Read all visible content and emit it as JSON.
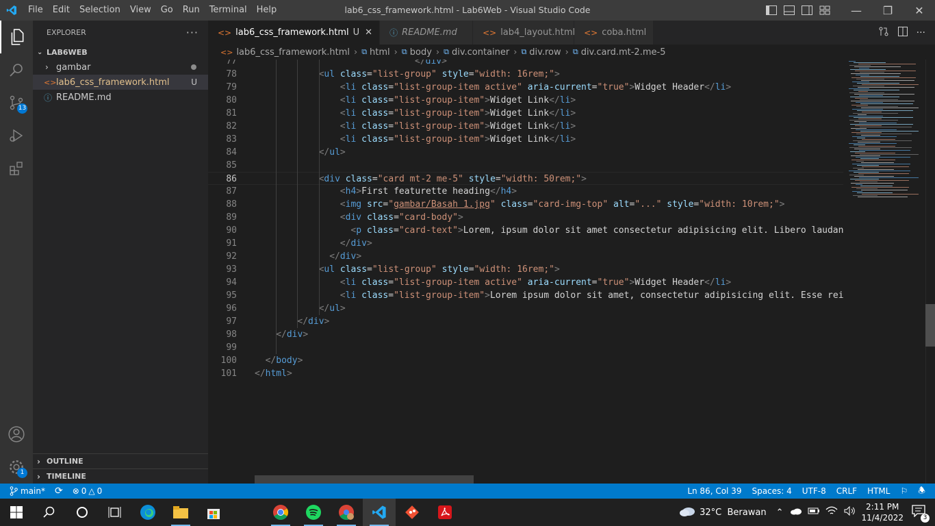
{
  "titlebar": {
    "menu": [
      "File",
      "Edit",
      "Selection",
      "View",
      "Go",
      "Run",
      "Terminal",
      "Help"
    ],
    "window_title": "lab6_css_framework.html - Lab6Web - Visual Studio Code"
  },
  "activity_bar": {
    "items": [
      "explorer-icon",
      "search-icon",
      "source-control-icon",
      "run-debug-icon",
      "extensions-icon"
    ],
    "source_control_badge": "13",
    "settings_badge": "1"
  },
  "explorer": {
    "header": "EXPLORER",
    "more": "···",
    "folder": "LAB6WEB",
    "items": [
      {
        "label": "gambar",
        "type": "folder"
      },
      {
        "label": "lab6_css_framework.html",
        "type": "html",
        "status": "U"
      },
      {
        "label": "README.md",
        "type": "md"
      }
    ],
    "outline": "OUTLINE",
    "timeline": "TIMELINE"
  },
  "tabs": [
    {
      "label": "lab6_css_framework.html",
      "status": "U",
      "active": true
    },
    {
      "label": "README.md"
    },
    {
      "label": "lab4_layout.html"
    },
    {
      "label": "coba.html"
    }
  ],
  "breadcrumb": [
    "lab6_css_framework.html",
    "html",
    "body",
    "div.container",
    "div.row",
    "div.card.mt-2.me-5"
  ],
  "editor": {
    "lines": [
      {
        "n": "77",
        "indent": 30,
        "segs": [
          [
            "b",
            "</"
          ],
          [
            "t",
            "div"
          ],
          [
            "b",
            ">"
          ]
        ]
      },
      {
        "n": "78",
        "indent": 12,
        "segs": [
          [
            "b",
            "<"
          ],
          [
            "t",
            "ul"
          ],
          [
            "w",
            " "
          ],
          [
            "a",
            "class"
          ],
          [
            "w",
            "="
          ],
          [
            "s",
            "\"list-group\""
          ],
          [
            "w",
            " "
          ],
          [
            "a",
            "style"
          ],
          [
            "w",
            "="
          ],
          [
            "s",
            "\"width: 16rem;\""
          ],
          [
            "b",
            ">"
          ]
        ]
      },
      {
        "n": "79",
        "indent": 16,
        "segs": [
          [
            "b",
            "<"
          ],
          [
            "t",
            "li"
          ],
          [
            "w",
            " "
          ],
          [
            "a",
            "class"
          ],
          [
            "w",
            "="
          ],
          [
            "s",
            "\"list-group-item active\""
          ],
          [
            "w",
            " "
          ],
          [
            "a",
            "aria-current"
          ],
          [
            "w",
            "="
          ],
          [
            "s",
            "\"true\""
          ],
          [
            "b",
            ">"
          ],
          [
            "w",
            "Widget Header"
          ],
          [
            "b",
            "</"
          ],
          [
            "t",
            "li"
          ],
          [
            "b",
            ">"
          ]
        ]
      },
      {
        "n": "80",
        "indent": 16,
        "segs": [
          [
            "b",
            "<"
          ],
          [
            "t",
            "li"
          ],
          [
            "w",
            " "
          ],
          [
            "a",
            "class"
          ],
          [
            "w",
            "="
          ],
          [
            "s",
            "\"list-group-item\""
          ],
          [
            "b",
            ">"
          ],
          [
            "w",
            "Widget Link"
          ],
          [
            "b",
            "</"
          ],
          [
            "t",
            "li"
          ],
          [
            "b",
            ">"
          ]
        ]
      },
      {
        "n": "81",
        "indent": 16,
        "segs": [
          [
            "b",
            "<"
          ],
          [
            "t",
            "li"
          ],
          [
            "w",
            " "
          ],
          [
            "a",
            "class"
          ],
          [
            "w",
            "="
          ],
          [
            "s",
            "\"list-group-item\""
          ],
          [
            "b",
            ">"
          ],
          [
            "w",
            "Widget Link"
          ],
          [
            "b",
            "</"
          ],
          [
            "t",
            "li"
          ],
          [
            "b",
            ">"
          ]
        ]
      },
      {
        "n": "82",
        "indent": 16,
        "segs": [
          [
            "b",
            "<"
          ],
          [
            "t",
            "li"
          ],
          [
            "w",
            " "
          ],
          [
            "a",
            "class"
          ],
          [
            "w",
            "="
          ],
          [
            "s",
            "\"list-group-item\""
          ],
          [
            "b",
            ">"
          ],
          [
            "w",
            "Widget Link"
          ],
          [
            "b",
            "</"
          ],
          [
            "t",
            "li"
          ],
          [
            "b",
            ">"
          ]
        ]
      },
      {
        "n": "83",
        "indent": 16,
        "segs": [
          [
            "b",
            "<"
          ],
          [
            "t",
            "li"
          ],
          [
            "w",
            " "
          ],
          [
            "a",
            "class"
          ],
          [
            "w",
            "="
          ],
          [
            "s",
            "\"list-group-item\""
          ],
          [
            "b",
            ">"
          ],
          [
            "w",
            "Widget Link"
          ],
          [
            "b",
            "</"
          ],
          [
            "t",
            "li"
          ],
          [
            "b",
            ">"
          ]
        ]
      },
      {
        "n": "84",
        "indent": 12,
        "segs": [
          [
            "b",
            "</"
          ],
          [
            "t",
            "ul"
          ],
          [
            "b",
            ">"
          ]
        ]
      },
      {
        "n": "85",
        "indent": 0,
        "segs": []
      },
      {
        "n": "86",
        "indent": 12,
        "segs": [
          [
            "b",
            "<"
          ],
          [
            "t",
            "div"
          ],
          [
            "w",
            " "
          ],
          [
            "a",
            "class"
          ],
          [
            "w",
            "="
          ],
          [
            "s",
            "\"card mt-2 me-5\""
          ],
          [
            "w",
            " "
          ],
          [
            "a",
            "style"
          ],
          [
            "w",
            "="
          ],
          [
            "s",
            "\"width: 50rem;\""
          ],
          [
            "b",
            ">"
          ]
        ]
      },
      {
        "n": "87",
        "indent": 16,
        "segs": [
          [
            "b",
            "<"
          ],
          [
            "t",
            "h4"
          ],
          [
            "b",
            ">"
          ],
          [
            "w",
            "First featurette heading"
          ],
          [
            "b",
            "</"
          ],
          [
            "t",
            "h4"
          ],
          [
            "b",
            ">"
          ]
        ]
      },
      {
        "n": "88",
        "indent": 16,
        "segs": [
          [
            "b",
            "<"
          ],
          [
            "t",
            "img"
          ],
          [
            "w",
            " "
          ],
          [
            "a",
            "src"
          ],
          [
            "w",
            "="
          ],
          [
            "s",
            "\""
          ],
          [
            "su",
            "gambar/Basah 1.jpg"
          ],
          [
            "s",
            "\""
          ],
          [
            "w",
            " "
          ],
          [
            "a",
            "class"
          ],
          [
            "w",
            "="
          ],
          [
            "s",
            "\"card-img-top\""
          ],
          [
            "w",
            " "
          ],
          [
            "a",
            "alt"
          ],
          [
            "w",
            "="
          ],
          [
            "s",
            "\"...\""
          ],
          [
            "w",
            " "
          ],
          [
            "a",
            "style"
          ],
          [
            "w",
            "="
          ],
          [
            "s",
            "\"width: 10rem;\""
          ],
          [
            "b",
            ">"
          ]
        ]
      },
      {
        "n": "89",
        "indent": 16,
        "segs": [
          [
            "b",
            "<"
          ],
          [
            "t",
            "div"
          ],
          [
            "w",
            " "
          ],
          [
            "a",
            "class"
          ],
          [
            "w",
            "="
          ],
          [
            "s",
            "\"card-body\""
          ],
          [
            "b",
            ">"
          ]
        ]
      },
      {
        "n": "90",
        "indent": 18,
        "segs": [
          [
            "b",
            "<"
          ],
          [
            "t",
            "p"
          ],
          [
            "w",
            " "
          ],
          [
            "a",
            "class"
          ],
          [
            "w",
            "="
          ],
          [
            "s",
            "\"card-text\""
          ],
          [
            "b",
            ">"
          ],
          [
            "w",
            "Lorem, ipsum dolor sit amet consectetur adipisicing elit. Libero laudanti"
          ]
        ]
      },
      {
        "n": "91",
        "indent": 16,
        "segs": [
          [
            "b",
            "</"
          ],
          [
            "t",
            "div"
          ],
          [
            "b",
            ">"
          ]
        ]
      },
      {
        "n": "92",
        "indent": 14,
        "segs": [
          [
            "b",
            "</"
          ],
          [
            "t",
            "div"
          ],
          [
            "b",
            ">"
          ]
        ]
      },
      {
        "n": "93",
        "indent": 12,
        "segs": [
          [
            "b",
            "<"
          ],
          [
            "t",
            "ul"
          ],
          [
            "w",
            " "
          ],
          [
            "a",
            "class"
          ],
          [
            "w",
            "="
          ],
          [
            "s",
            "\"list-group\""
          ],
          [
            "w",
            " "
          ],
          [
            "a",
            "style"
          ],
          [
            "w",
            "="
          ],
          [
            "s",
            "\"width: 16rem;\""
          ],
          [
            "b",
            ">"
          ]
        ]
      },
      {
        "n": "94",
        "indent": 16,
        "segs": [
          [
            "b",
            "<"
          ],
          [
            "t",
            "li"
          ],
          [
            "w",
            " "
          ],
          [
            "a",
            "class"
          ],
          [
            "w",
            "="
          ],
          [
            "s",
            "\"list-group-item active\""
          ],
          [
            "w",
            " "
          ],
          [
            "a",
            "aria-current"
          ],
          [
            "w",
            "="
          ],
          [
            "s",
            "\"true\""
          ],
          [
            "b",
            ">"
          ],
          [
            "w",
            "Widget Header"
          ],
          [
            "b",
            "</"
          ],
          [
            "t",
            "li"
          ],
          [
            "b",
            ">"
          ]
        ]
      },
      {
        "n": "95",
        "indent": 16,
        "segs": [
          [
            "b",
            "<"
          ],
          [
            "t",
            "li"
          ],
          [
            "w",
            " "
          ],
          [
            "a",
            "class"
          ],
          [
            "w",
            "="
          ],
          [
            "s",
            "\"list-group-item\""
          ],
          [
            "b",
            ">"
          ],
          [
            "w",
            "Lorem ipsum dolor sit amet, consectetur adipisicing elit. Esse reici"
          ]
        ]
      },
      {
        "n": "96",
        "indent": 12,
        "segs": [
          [
            "b",
            "</"
          ],
          [
            "t",
            "ul"
          ],
          [
            "b",
            ">"
          ]
        ]
      },
      {
        "n": "97",
        "indent": 8,
        "segs": [
          [
            "b",
            "</"
          ],
          [
            "t",
            "div"
          ],
          [
            "b",
            ">"
          ]
        ]
      },
      {
        "n": "98",
        "indent": 4,
        "segs": [
          [
            "b",
            "</"
          ],
          [
            "t",
            "div"
          ],
          [
            "b",
            ">"
          ]
        ]
      },
      {
        "n": "99",
        "indent": 0,
        "segs": []
      },
      {
        "n": "100",
        "indent": 2,
        "segs": [
          [
            "b",
            "</"
          ],
          [
            "t",
            "body"
          ],
          [
            "b",
            ">"
          ]
        ]
      },
      {
        "n": "101",
        "indent": 0,
        "segs": [
          [
            "b",
            "</"
          ],
          [
            "t",
            "html"
          ],
          [
            "b",
            ">"
          ]
        ]
      }
    ],
    "current_line": "86"
  },
  "statusbar": {
    "branch": "main*",
    "errors": "0",
    "warnings": "0",
    "cursor": "Ln 86, Col 39",
    "spaces": "Spaces: 4",
    "encoding": "UTF-8",
    "eol": "CRLF",
    "language": "HTML"
  },
  "taskbar": {
    "weather": "32°C  Berawan",
    "time": "2:11 PM",
    "date": "11/4/2022",
    "notification_count": "3"
  },
  "colors": {
    "accent": "#007acc",
    "tag": "#569cd6",
    "attribute": "#9cdcfe",
    "string": "#ce9178",
    "bracket": "#808080"
  }
}
